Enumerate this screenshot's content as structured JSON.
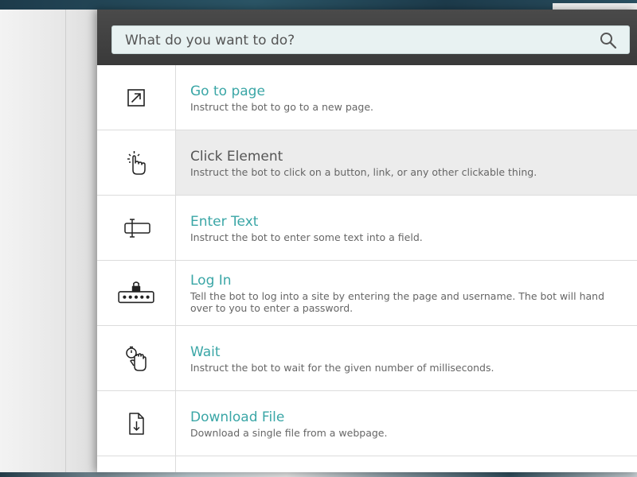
{
  "search": {
    "placeholder": "What do you want to do?"
  },
  "actions": [
    {
      "icon": "arrow-up-right-box-icon",
      "title": "Go to page",
      "description": "Instruct the bot to go to a new page."
    },
    {
      "icon": "tap-hand-icon",
      "title": "Click Element",
      "description": "Instruct the bot to click on a button, link, or any other clickable thing."
    },
    {
      "icon": "text-cursor-field-icon",
      "title": "Enter Text",
      "description": "Instruct the bot to enter some text into a field."
    },
    {
      "icon": "password-lock-icon",
      "title": "Log In",
      "description": "Tell the bot to log into a site by entering the page and username. The bot will hand over to you to enter a password."
    },
    {
      "icon": "stopwatch-hand-icon",
      "title": "Wait",
      "description": "Instruct the bot to wait for the given number of milliseconds."
    },
    {
      "icon": "download-file-icon",
      "title": "Download File",
      "description": "Download a single file from a webpage."
    }
  ],
  "colors": {
    "accent": "#3aa6a6",
    "hover_bg": "#ececec",
    "header_bg": "#3f3f3f",
    "search_bg": "#e8f2f2"
  }
}
